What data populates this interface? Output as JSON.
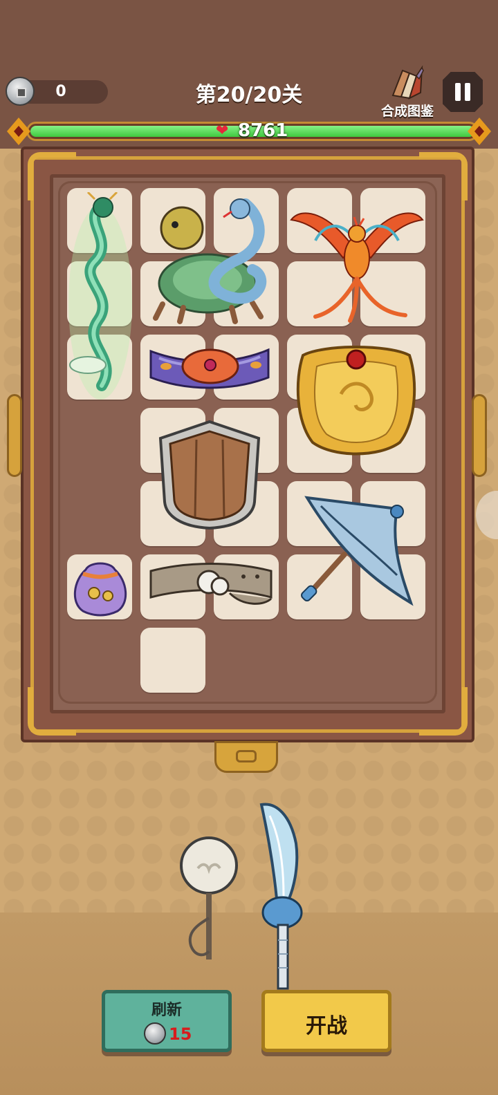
{
  "header": {
    "coins": "0",
    "level": "第20/20关",
    "codex_label": "合成图鉴",
    "pause_icon": "pause-icon"
  },
  "health": {
    "value": "8761",
    "icon": "heart-icon",
    "fill_fraction": 1.0,
    "bar_color": "#3fc93f"
  },
  "board": {
    "items": [
      {
        "name": "azure-dragon",
        "icon": "dragon-icon"
      },
      {
        "name": "black-tortoise-snake",
        "icon": "tortoise-snake-icon"
      },
      {
        "name": "vermilion-phoenix",
        "icon": "phoenix-icon"
      },
      {
        "name": "jeweled-belt",
        "icon": "purple-belt-icon"
      },
      {
        "name": "golden-shield",
        "icon": "golden-shield-icon"
      },
      {
        "name": "wooden-shield",
        "icon": "wooden-shield-icon"
      },
      {
        "name": "umbrella",
        "icon": "umbrella-icon"
      },
      {
        "name": "treasure-pouch",
        "icon": "pouch-icon"
      },
      {
        "name": "leather-belt",
        "icon": "leather-belt-icon"
      }
    ]
  },
  "tray": {
    "items": [
      {
        "name": "white-orb-staff",
        "icon": "orb-staff-icon"
      },
      {
        "name": "broadsword",
        "icon": "broadsword-icon"
      }
    ]
  },
  "buttons": {
    "refresh_label": "刷新",
    "refresh_cost": "15",
    "fight_label": "开战"
  },
  "colors": {
    "top_band": "#7a5444",
    "board_frame": "#8a5644",
    "gold_trim": "#d6a23c",
    "refresh_button": "#5fb29c",
    "fight_button": "#f2c94a",
    "cost_color": "#d81c1c"
  }
}
